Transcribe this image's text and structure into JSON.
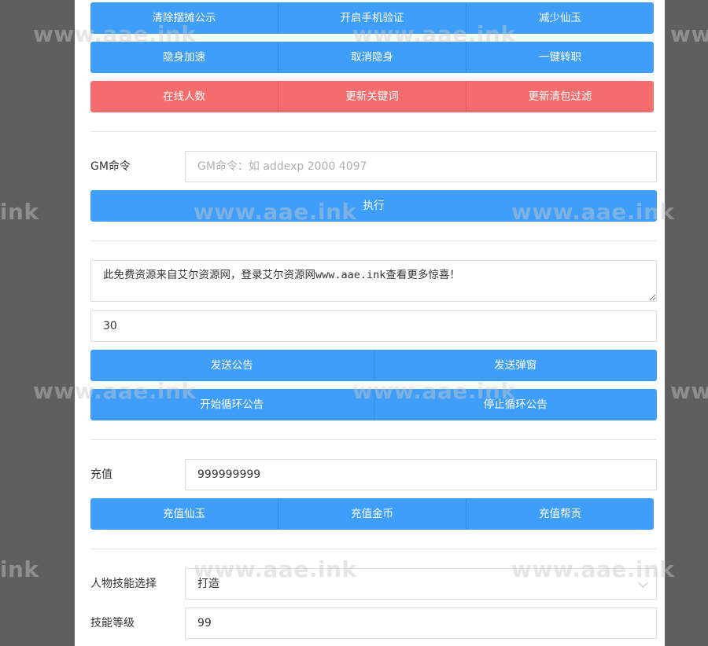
{
  "row1": [
    "清除摆摊公示",
    "开启手机验证",
    "减少仙玉"
  ],
  "row2": [
    "隐身加速",
    "取消隐身",
    "一键转职"
  ],
  "row3": [
    "在线人数",
    "更新关键词",
    "更新清包过滤"
  ],
  "gm": {
    "label": "GM命令",
    "placeholder": "GM命令：如 addexp 2000 4097",
    "execute": "执行"
  },
  "announce": {
    "text": "此免费资源来自艾尔资源网，登录艾尔资源网www.aae.ink查看更多惊喜！",
    "seconds": "30",
    "buttons_a": [
      "发送公告",
      "发送弹窗"
    ],
    "buttons_b": [
      "开始循环公告",
      "停止循环公告"
    ]
  },
  "recharge": {
    "label": "充值",
    "value": "999999999",
    "buttons": [
      "充值仙玉",
      "充值金币",
      "充值帮贡"
    ]
  },
  "skill": {
    "select_label": "人物技能选择",
    "selected": "打造",
    "level_label": "技能等级",
    "level": "99"
  },
  "watermark": "www.aae.ink",
  "colors": {
    "primary": "#3e9efa",
    "danger": "#f56c6c",
    "backdrop": "#5f5f5f"
  }
}
